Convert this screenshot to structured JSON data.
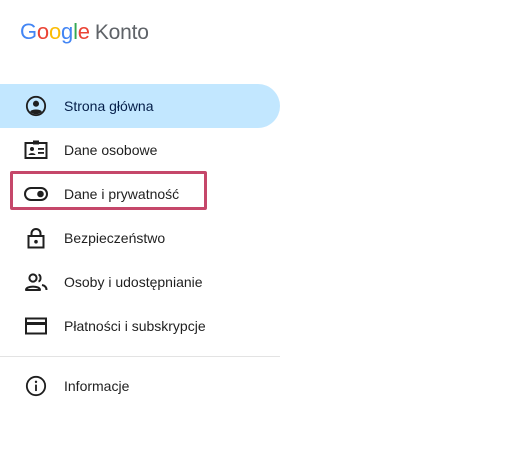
{
  "logo": {
    "letters": [
      {
        "char": "G",
        "color": "#4285F4"
      },
      {
        "char": "o",
        "color": "#EA4335"
      },
      {
        "char": "o",
        "color": "#FBBC05"
      },
      {
        "char": "g",
        "color": "#4285F4"
      },
      {
        "char": "l",
        "color": "#34A853"
      },
      {
        "char": "e",
        "color": "#EA4335"
      }
    ],
    "product": "Konto"
  },
  "nav": {
    "items": [
      {
        "label": "Strona główna",
        "icon": "account-circle-icon",
        "active": true
      },
      {
        "label": "Dane osobowe",
        "icon": "id-card-icon"
      },
      {
        "label": "Dane i prywatność",
        "icon": "toggle-icon",
        "highlighted": true
      },
      {
        "label": "Bezpieczeństwo",
        "icon": "lock-icon"
      },
      {
        "label": "Osoby i udostępnianie",
        "icon": "people-icon"
      },
      {
        "label": "Płatności i subskrypcje",
        "icon": "credit-card-icon"
      }
    ],
    "footer_items": [
      {
        "label": "Informacje",
        "icon": "info-icon"
      }
    ]
  },
  "colors": {
    "active_bg": "#c2e7ff",
    "highlight_border": "#c5476a",
    "icon": "#1f1f1f"
  }
}
